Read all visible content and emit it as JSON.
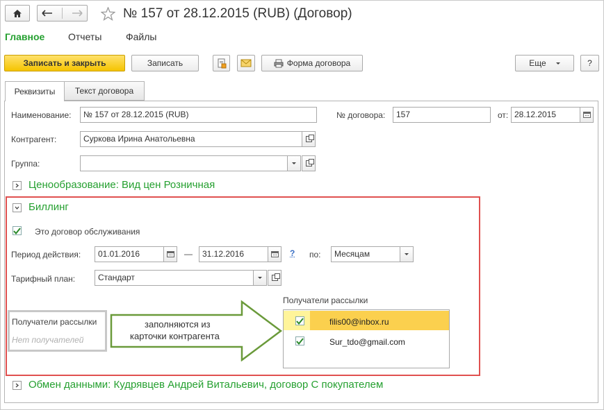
{
  "window": {
    "title": "№ 157 от 28.12.2015 (RUB) (Договор)"
  },
  "nav": {
    "tabs": [
      {
        "label": "Главное"
      },
      {
        "label": "Отчеты"
      },
      {
        "label": "Файлы"
      }
    ]
  },
  "toolbar": {
    "save_close": "Записать и закрыть",
    "save": "Записать",
    "contract_form": "Форма договора",
    "more": "Еще",
    "help": "?"
  },
  "form_tabs": [
    {
      "label": "Реквизиты"
    },
    {
      "label": "Текст договора"
    }
  ],
  "fields": {
    "name_label": "Наименование:",
    "name_value": "№ 157 от 28.12.2015 (RUB)",
    "number_label": "№ договора:",
    "number_value": "157",
    "date_label": "от:",
    "date_value": "28.12.2015",
    "counterparty_label": "Контрагент:",
    "counterparty_value": "Суркова Ирина Анатольевна",
    "group_label": "Группа:",
    "group_value": ""
  },
  "pricing": {
    "header": "Ценообразование: Вид цен Розничная"
  },
  "billing": {
    "header": "Биллинг",
    "service_contract_label": "Это договор обслуживания",
    "service_contract_checked": true,
    "period_label": "Период действия:",
    "period_from": "01.01.2016",
    "period_dash": "—",
    "period_to": "31.12.2016",
    "period_help": "?",
    "by_label": "по:",
    "by_value": "Месяцам",
    "tariff_label": "Тарифный план:",
    "tariff_value": "Стандарт",
    "left_box": {
      "title": "Получатели рассылки",
      "empty": "Нет получателей"
    },
    "arrow_text_1": "заполняются из",
    "arrow_text_2": "карточки контрагента",
    "recipients_title": "Получатели рассылки",
    "recipients": [
      {
        "email": "filis00@inbox.ru",
        "checked": true,
        "selected": true
      },
      {
        "email": "Sur_tdo@gmail.com",
        "checked": true,
        "selected": false
      }
    ]
  },
  "exchange": {
    "header": "Обмен данными: Кудрявцев Андрей Витальевич, договор С покупателем"
  },
  "colors": {
    "accent_green": "#25a030",
    "highlight_red": "#e0504f",
    "selected_row": "#fbd04e",
    "arrow_green": "#6a9a3a"
  },
  "icons": {
    "home": "home-icon",
    "back": "arrow-left-icon",
    "forward": "arrow-right-icon",
    "favorite": "star-icon",
    "print": "printer-icon",
    "mail": "envelope-icon",
    "calendar": "calendar-icon",
    "open": "open-icon",
    "dropdown": "chevron-down-icon",
    "check": "checkmark-icon"
  }
}
